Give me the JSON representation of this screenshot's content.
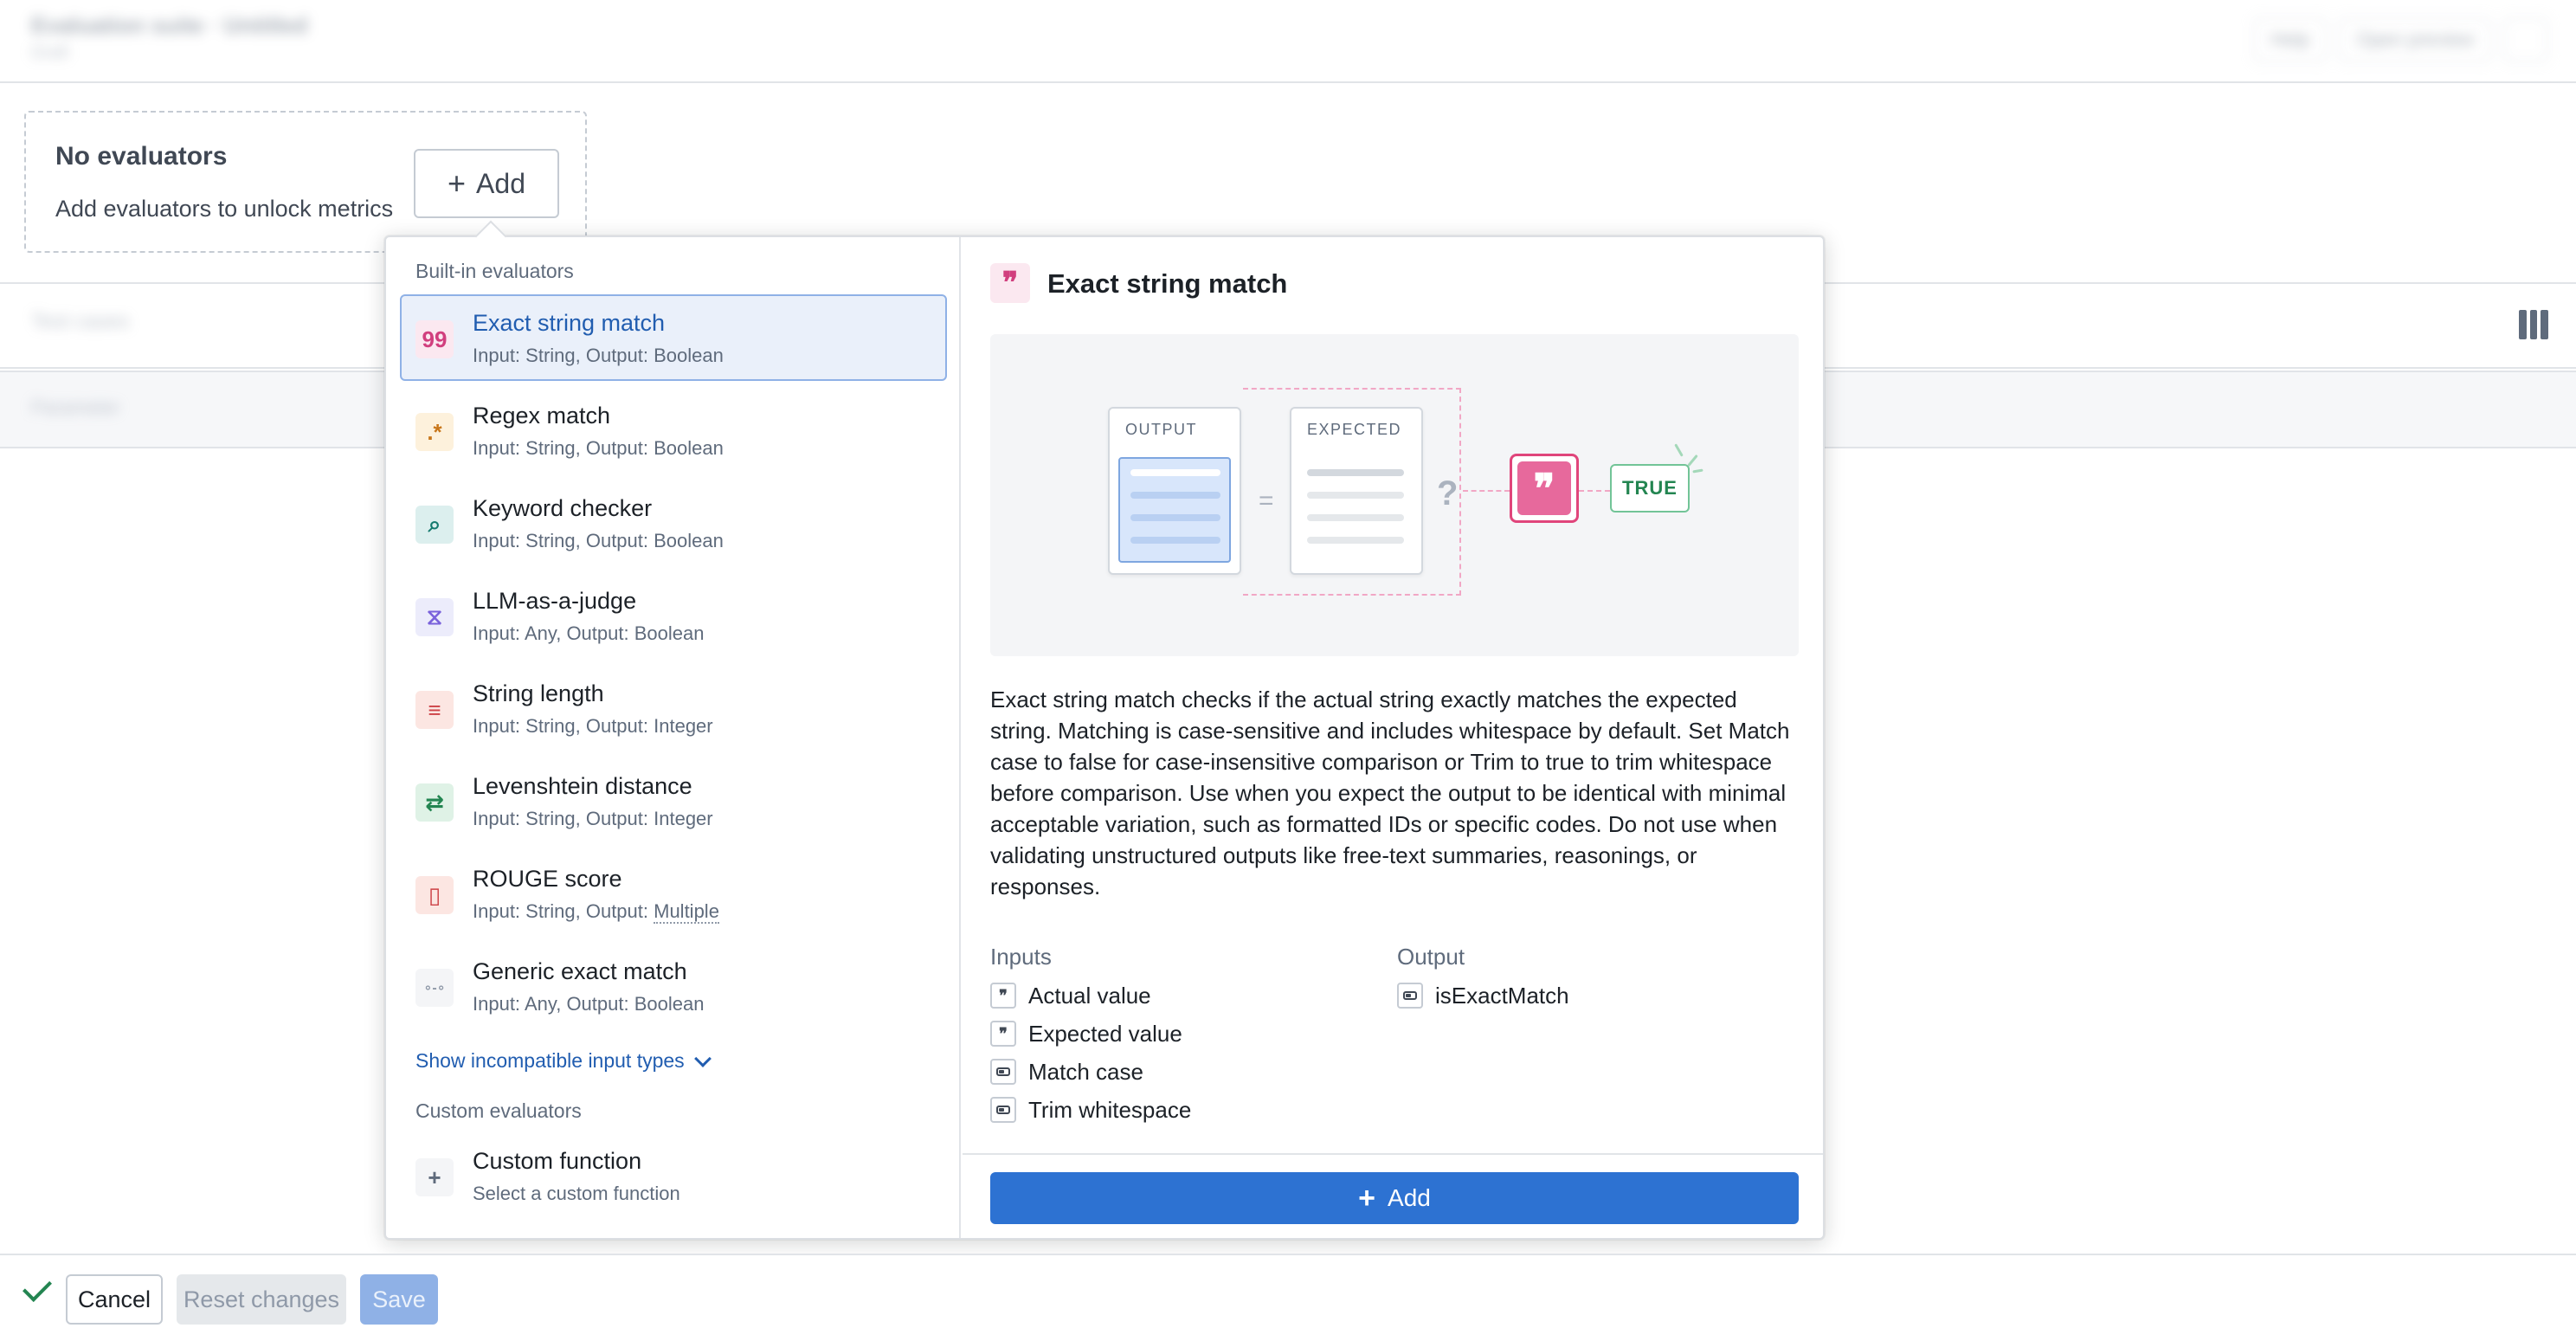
{
  "header": {
    "title": "Evaluation suite · Untitled",
    "subtitle": "Draft",
    "actions": [
      "Help",
      "Open preview"
    ]
  },
  "empty_state": {
    "title": "No evaluators",
    "subtitle": "Add evaluators to unlock metrics",
    "add_label": "Add"
  },
  "background": {
    "strip1_text": "Test cases",
    "strip2_text": "Parameter"
  },
  "popover": {
    "builtin_label": "Built-in evaluators",
    "evaluators": [
      {
        "name": "Exact string match",
        "desc": "Input: String, Output: Boolean",
        "icon": "quote-icon",
        "glyph": "99",
        "bg": "#fbe8f0",
        "fg": "#d13f7e",
        "selected": true
      },
      {
        "name": "Regex match",
        "desc": "Input: String, Output: Boolean",
        "icon": "regex-icon",
        "glyph": ".*",
        "bg": "#fdf1dc",
        "fg": "#c87619",
        "selected": false
      },
      {
        "name": "Keyword checker",
        "desc": "Input: String, Output: Boolean",
        "icon": "search-text-icon",
        "glyph": "⌕",
        "bg": "#dcefee",
        "fg": "#147a6e",
        "selected": false
      },
      {
        "name": "LLM-as-a-judge",
        "desc": "Input: Any, Output: Boolean",
        "icon": "judge-icon",
        "glyph": "⧖",
        "bg": "#ececfb",
        "fg": "#7961db",
        "selected": false
      },
      {
        "name": "String length",
        "desc": "Input: String, Output: Integer",
        "icon": "text-length-icon",
        "glyph": "≡",
        "bg": "#fce6e2",
        "fg": "#cd4246",
        "selected": false
      },
      {
        "name": "Levenshtein distance",
        "desc": "Input: String, Output: Integer",
        "icon": "distance-icon",
        "glyph": "⇄",
        "bg": "#dff2e6",
        "fg": "#238551",
        "selected": false
      },
      {
        "name": "ROUGE score",
        "desc_prefix": "Input: String, Output: ",
        "desc_suffix": "Multiple",
        "icon": "book-icon",
        "glyph": "▯",
        "bg": "#fce6e2",
        "fg": "#cd4246",
        "selected": false
      },
      {
        "name": "Generic exact match",
        "desc": "Input: Any, Output: Boolean",
        "icon": "link-icon",
        "glyph": "∘-∘",
        "bg": "#f4f5f7",
        "fg": "#8f99a8",
        "selected": false
      }
    ],
    "show_incompatible": "Show incompatible input types",
    "custom_label": "Custom evaluators",
    "custom": {
      "name": "Custom function",
      "desc": "Select a custom function",
      "glyph": "+"
    },
    "detail": {
      "title": "Exact string match",
      "illustration": {
        "output_label": "OUTPUT",
        "expected_label": "EXPECTED",
        "equals": "=",
        "question": "?",
        "result": "TRUE"
      },
      "description": "Exact string match checks if the actual string exactly matches the expected string. Matching is case-sensitive and includes whitespace by default. Set Match case to false for case-insensitive comparison or Trim to true to trim whitespace before comparison. Use when you expect the output to be identical with minimal acceptable variation, such as formatted IDs or specific codes. Do not use when validating unstructured outputs like free-text summaries, reasonings, or responses.",
      "inputs_label": "Inputs",
      "inputs": [
        {
          "name": "Actual value",
          "type": "string"
        },
        {
          "name": "Expected value",
          "type": "string"
        },
        {
          "name": "Match case",
          "type": "toggle"
        },
        {
          "name": "Trim whitespace",
          "type": "toggle"
        }
      ],
      "output_label": "Output",
      "outputs": [
        {
          "name": "isExactMatch",
          "type": "toggle"
        }
      ],
      "add_label": "Add"
    }
  },
  "footer": {
    "cancel": "Cancel",
    "reset": "Reset changes",
    "save": "Save"
  },
  "colors": {
    "accent": "#2d72d2",
    "selected_bg": "#eaf0fa",
    "success": "#238551",
    "pink": "#e0457b"
  }
}
